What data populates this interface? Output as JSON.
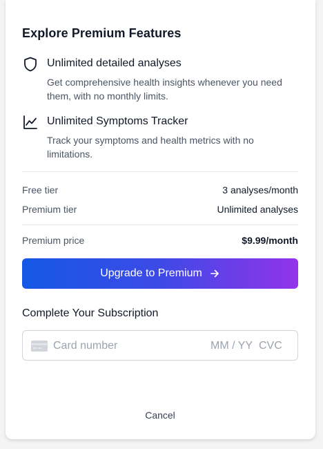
{
  "modal": {
    "title": "Explore Premium Features",
    "features": [
      {
        "icon": "shield-icon",
        "name": "Unlimited detailed analyses",
        "description": "Get comprehensive health insights whenever you need them, with no monthly limits."
      },
      {
        "icon": "line-chart-icon",
        "name": "Unlimited Symptoms Tracker",
        "description": "Track your symptoms and health metrics with no limitations."
      }
    ],
    "tiers": [
      {
        "label": "Free tier",
        "value": "3 analyses/month"
      },
      {
        "label": "Premium tier",
        "value": "Unlimited analyses"
      }
    ],
    "price": {
      "label": "Premium price",
      "value": "$9.99/month"
    },
    "upgrade_button": {
      "label": "Upgrade to Premium",
      "icon": "arrow-right-icon"
    },
    "subscription": {
      "heading": "Complete Your Subscription",
      "card_number_placeholder": "Card number",
      "expiry_placeholder": "MM / YY",
      "cvc_placeholder": "CVC",
      "card_icon": "credit-card-icon"
    },
    "cancel_label": "Cancel"
  },
  "colors": {
    "gradient_start": "#1558e6",
    "gradient_end": "#9333ea",
    "text_primary": "#111827",
    "text_secondary": "#4b5563"
  }
}
